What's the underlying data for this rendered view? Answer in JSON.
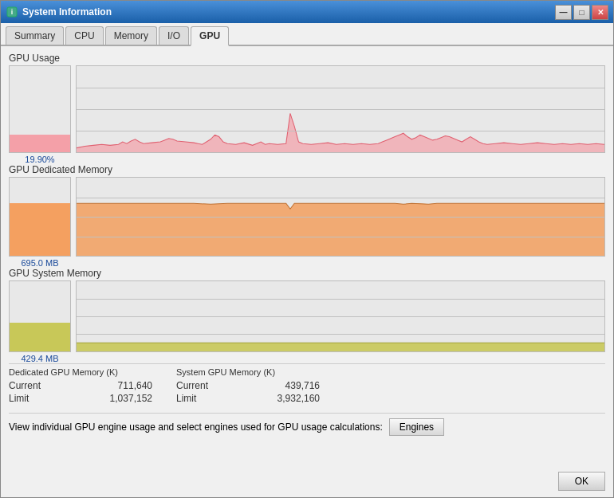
{
  "window": {
    "title": "System Information",
    "icon": "ℹ"
  },
  "titlebar_buttons": {
    "minimize": "—",
    "maximize": "□",
    "close": "✕"
  },
  "tabs": [
    {
      "id": "summary",
      "label": "Summary",
      "active": false
    },
    {
      "id": "cpu",
      "label": "CPU",
      "active": false
    },
    {
      "id": "memory",
      "label": "Memory",
      "active": false
    },
    {
      "id": "io",
      "label": "I/O",
      "active": false
    },
    {
      "id": "gpu",
      "label": "GPU",
      "active": true
    }
  ],
  "gpu_usage": {
    "section_label": "GPU Usage",
    "mini_value": "19.90%",
    "mini_fill_height_pct": 20
  },
  "gpu_dedicated": {
    "section_label": "GPU Dedicated Memory",
    "mini_value": "695.0 MB",
    "mini_fill_height_pct": 67
  },
  "gpu_system": {
    "section_label": "GPU System Memory",
    "mini_value": "429.4 MB",
    "mini_fill_height_pct": 41
  },
  "stats": {
    "dedicated_header": "Dedicated GPU Memory",
    "dedicated_header_unit": "(K)",
    "dedicated_current_label": "Current",
    "dedicated_current_value": "711,640",
    "dedicated_limit_label": "Limit",
    "dedicated_limit_value": "1,037,152",
    "system_header": "System GPU Memory",
    "system_header_unit": "(K)",
    "system_current_label": "Current",
    "system_current_value": "439,716",
    "system_limit_label": "Limit",
    "system_limit_value": "3,932,160"
  },
  "engines": {
    "description": "View individual GPU engine usage and select engines used for GPU usage calculations:",
    "button_label": "Engines"
  },
  "ok_button": "OK"
}
